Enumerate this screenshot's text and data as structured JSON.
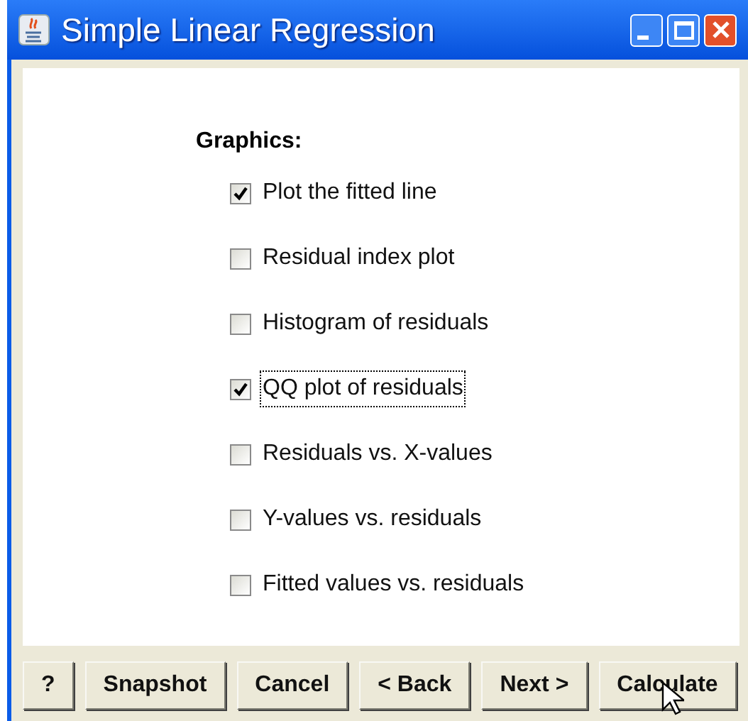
{
  "window": {
    "title": "Simple Linear Regression"
  },
  "section_label": "Graphics:",
  "options": [
    {
      "label": "Plot the fitted line",
      "checked": true,
      "focused": false
    },
    {
      "label": "Residual index plot",
      "checked": false,
      "focused": false
    },
    {
      "label": "Histogram of residuals",
      "checked": false,
      "focused": false
    },
    {
      "label": "QQ plot of residuals",
      "checked": true,
      "focused": true
    },
    {
      "label": "Residuals vs. X-values",
      "checked": false,
      "focused": false
    },
    {
      "label": "Y-values vs. residuals",
      "checked": false,
      "focused": false
    },
    {
      "label": "Fitted values vs. residuals",
      "checked": false,
      "focused": false
    }
  ],
  "buttons": [
    "?",
    "Snapshot",
    "Cancel",
    "< Back",
    "Next >",
    "Calculate"
  ]
}
